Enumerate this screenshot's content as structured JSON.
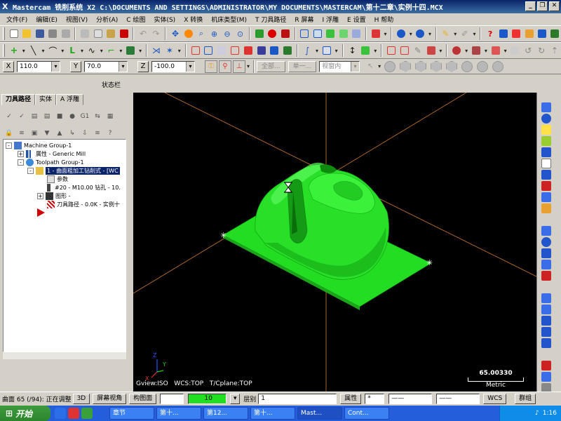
{
  "window": {
    "title": "Mastercam 铣削系统  X2  C:\\DOCUMENTS AND SETTINGS\\ADMINISTRATOR\\MY DOCUMENTS\\MASTERCAM\\第十二章\\实例十四.MCX"
  },
  "menu": [
    "文件(F)",
    "编辑(E)",
    "视图(V)",
    "分析(A)",
    "C 绘图",
    "实体(S)",
    "X 转换",
    "机床类型(M)",
    "T 刀具路径",
    "R 屏幕",
    "I 浮雕",
    "E 设置",
    "H 帮助"
  ],
  "coords": {
    "x_label": "X",
    "x_value": "110.0",
    "y_label": "Y",
    "y_value": "70.0",
    "z_label": "Z",
    "z_value": "-100.0",
    "btn_all": "全部...",
    "btn_single": "单一...",
    "view_dropdown": "视窗内"
  },
  "status_label": "状态栏",
  "panel": {
    "tabs": [
      "刀具路径",
      "实体",
      "A 浮雕"
    ],
    "tree": [
      {
        "text": "Machine Group-1"
      },
      {
        "text": "属性 - Generic Mill"
      },
      {
        "text": "Toolpath Group-1"
      },
      {
        "text": "1 - 曲面粗加工钻削式 - [WC"
      },
      {
        "text": "参数"
      },
      {
        "text": "#20 - M10.00 钻孔 - 10."
      },
      {
        "text": "图形 -"
      },
      {
        "text": "刀具路径 - 0.0K - 实例十"
      }
    ]
  },
  "viewport": {
    "gview": "Gview:ISO",
    "wcs": "WCS:TOP",
    "tplane": "T/Cplane:TOP",
    "scale_value": "65.00330",
    "scale_unit": "Metric",
    "axis_x": "X",
    "axis_y": "Y",
    "axis_z": "Z",
    "background_color": "#000000",
    "model_color": "#22ee22"
  },
  "bottom": {
    "surface_status": "曲面 65 (/94): 正在调整",
    "btn_3d": "3D",
    "btn_screen_view": "屏幕视角",
    "btn_plane": "构图面",
    "z_value": "",
    "color_value": "10",
    "layer_label": "层别",
    "layer_value": "1",
    "attr_label": "属性",
    "wcs_label": "WCS",
    "group_label": "群组"
  },
  "taskbar": {
    "start": "开始",
    "tasks": [
      "章节",
      "第十...",
      "第12...",
      "第十...",
      "Mast...",
      "Cont..."
    ],
    "clock": "1:16"
  }
}
